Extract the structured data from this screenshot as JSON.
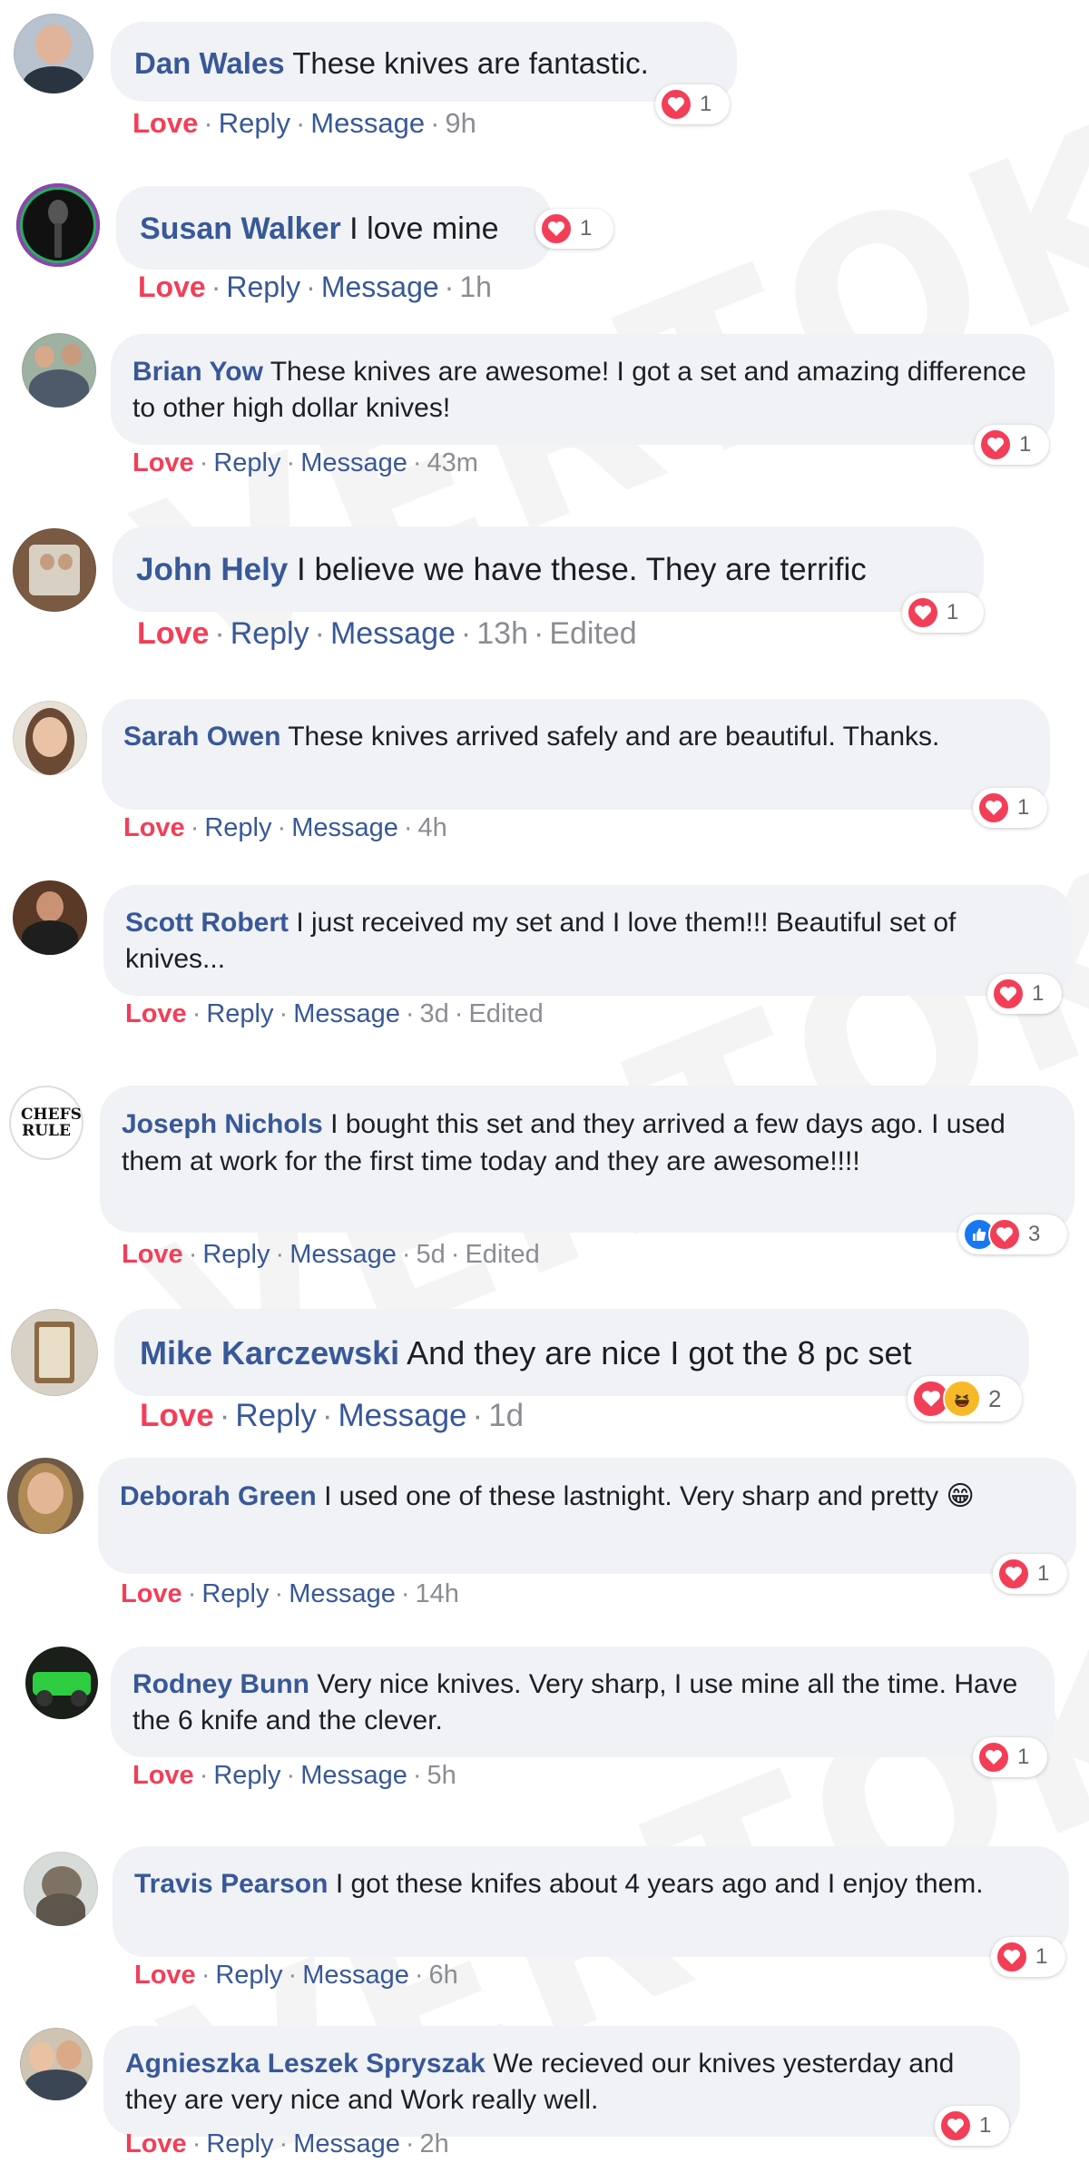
{
  "comments": [
    {
      "name": "Dan Wales",
      "text": "These knives are fantastic.",
      "love": "Love",
      "reply": "Reply",
      "message": "Message",
      "time": "9h",
      "reaction_count": "1"
    },
    {
      "name": "Susan Walker",
      "text": "I love mine",
      "love": "Love",
      "reply": "Reply",
      "message": "Message",
      "time": "1h",
      "reaction_count": "1"
    },
    {
      "name": "Brian Yow",
      "text": "These knives are awesome! I got a set and amazing difference to other high dollar knives!",
      "love": "Love",
      "reply": "Reply",
      "message": "Message",
      "time": "43m",
      "reaction_count": "1"
    },
    {
      "name": "John Hely",
      "text": "I believe we have these. They are terrific",
      "love": "Love",
      "reply": "Reply",
      "message": "Message",
      "time": "13h",
      "edited": "Edited",
      "reaction_count": "1"
    },
    {
      "name": "Sarah Owen",
      "text": "These knives arrived safely and are beautiful. Thanks.",
      "love": "Love",
      "reply": "Reply",
      "message": "Message",
      "time": "4h",
      "reaction_count": "1"
    },
    {
      "name": "Scott Robert",
      "text": "I just received my set and I love them!!! Beautiful set of knives...",
      "love": "Love",
      "reply": "Reply",
      "message": "Message",
      "time": "3d",
      "edited": "Edited",
      "reaction_count": "1"
    },
    {
      "name": "Joseph Nichols",
      "text": "I bought this set and they arrived a few days ago. I used them at work for the first time today and they are awesome!!!!",
      "love": "Love",
      "reply": "Reply",
      "message": "Message",
      "time": "5d",
      "edited": "Edited",
      "reaction_count": "3",
      "avatar_text": "CHEFS RULE"
    },
    {
      "name": "Mike Karczewski",
      "text": "And they are nice I got the 8 pc set",
      "love": "Love",
      "reply": "Reply",
      "message": "Message",
      "time": "1d",
      "reaction_count": "2"
    },
    {
      "name": "Deborah Green",
      "text": "I used one of these lastnight. Very sharp and pretty 😁",
      "love": "Love",
      "reply": "Reply",
      "message": "Message",
      "time": "14h",
      "reaction_count": "1"
    },
    {
      "name": "Rodney Bunn",
      "text": "Very nice knives. Very sharp, I use mine all the time. Have the 6 knife and the clever.",
      "love": "Love",
      "reply": "Reply",
      "message": "Message",
      "time": "5h",
      "reaction_count": "1"
    },
    {
      "name": "Travis Pearson",
      "text": "I got these knifes about 4 years ago and I enjoy them.",
      "love": "Love",
      "reply": "Reply",
      "message": "Message",
      "time": "6h",
      "reaction_count": "1"
    },
    {
      "name": "Agnieszka Leszek Spryszak",
      "text": "We recieved our knives yesterday and they are very nice and Work really well.",
      "love": "Love",
      "reply": "Reply",
      "message": "Message",
      "time": "2h",
      "reaction_count": "1"
    }
  ],
  "watermark": "VERTOKU",
  "colors": {
    "name": "#385898",
    "love": "#f33e58",
    "bubble": "#f0f2f5",
    "meta": "#8a8d91"
  },
  "icons": [
    "heart-reaction-icon",
    "like-reaction-icon",
    "haha-reaction-icon"
  ]
}
